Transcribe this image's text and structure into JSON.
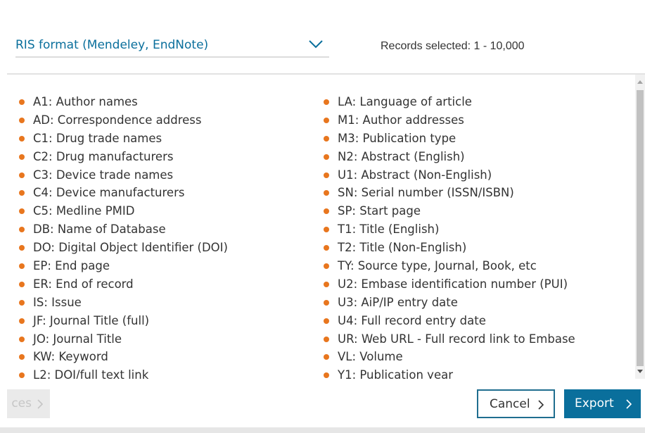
{
  "format_selector": {
    "selected": "RIS format (Mendeley, EndNote)"
  },
  "records_selected": "Records selected: 1 - 10,000",
  "fields": {
    "left": [
      "A1: Author names",
      "AD: Correspondence address",
      "C1: Drug trade names",
      "C2: Drug manufacturers",
      "C3: Device trade names",
      "C4: Device manufacturers",
      "C5: Medline PMID",
      "DB: Name of Database",
      "DO: Digital Object Identifier (DOI)",
      "EP: End page",
      "ER: End of record",
      "IS: Issue",
      "JF: Journal Title (full)",
      "JO: Journal Title",
      "KW: Keyword",
      "L2: DOI/full text link"
    ],
    "right": [
      "LA: Language of article",
      "M1: Author addresses",
      "M3: Publication type",
      "N2: Abstract (English)",
      "U1: Abstract (Non-English)",
      "SN: Serial number (ISSN/ISBN)",
      "SP: Start page",
      "T1: Title (English)",
      "T2: Title (Non-English)",
      "TY: Source type, Journal, Book, etc",
      "U2: Embase identification number (PUI)",
      "U3: AiP/IP entry date",
      "U4: Full record entry date",
      "UR: Web URL - Full record link to Embase",
      "VL: Volume",
      "Y1: Publication year"
    ]
  },
  "footer": {
    "prev_label": "ces",
    "cancel_label": "Cancel",
    "export_label": "Export"
  },
  "colors": {
    "accent": "#0a6f9c",
    "bullet": "#e8761e",
    "cancel_border": "#1f6e8f"
  },
  "icons": {
    "format_dropdown": "chevron-down-icon",
    "bullet": "bullet-icon",
    "button_arrow": "chevron-right-icon"
  }
}
